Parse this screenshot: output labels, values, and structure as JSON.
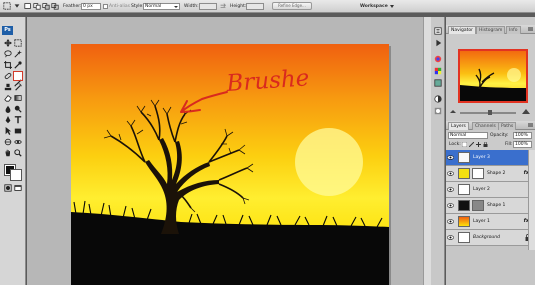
{
  "options_bar": {
    "feather_label": "Feather:",
    "feather_value": "0 px",
    "anti_alias_label": "Anti-alias",
    "style_label": "Style:",
    "style_value": "Normal",
    "width_label": "Width:",
    "height_label": "Height:",
    "refine_edge_label": "Refine Edge...",
    "workspace_label": "Workspace"
  },
  "tools": {
    "logo": "Ps"
  },
  "canvas": {
    "annotation_text": "Brushe",
    "colors": {
      "annotation": "#d92a1e",
      "tree": "#1b1208",
      "ground": "#080808"
    }
  },
  "navigator_panel": {
    "tabs": [
      "Navigator",
      "Histogram",
      "Info"
    ]
  },
  "layers_panel": {
    "tabs": [
      "Layers",
      "Channels",
      "Paths"
    ],
    "blend_mode": "Normal",
    "opacity_label": "Opacity:",
    "opacity_value": "100%",
    "lock_label": "Lock:",
    "fill_label": "Fill:",
    "fill_value": "100%",
    "layers": [
      {
        "name": "Layer 3",
        "selected": true,
        "mask": false,
        "fx": false,
        "thumb": "#f7f7f7"
      },
      {
        "name": "Shape 2",
        "selected": false,
        "mask": true,
        "fx": true,
        "thumb": "#f4e010"
      },
      {
        "name": "Layer 2",
        "selected": false,
        "mask": false,
        "fx": false,
        "thumb": "#ffffff"
      },
      {
        "name": "Shape 1",
        "selected": false,
        "mask": true,
        "fx": false,
        "thumb": "#111111"
      },
      {
        "name": "Layer 1",
        "selected": false,
        "mask": false,
        "fx": true,
        "thumb": "#f6b012"
      },
      {
        "name": "Background",
        "selected": false,
        "mask": false,
        "fx": false,
        "thumb": "#ffffff"
      }
    ]
  }
}
